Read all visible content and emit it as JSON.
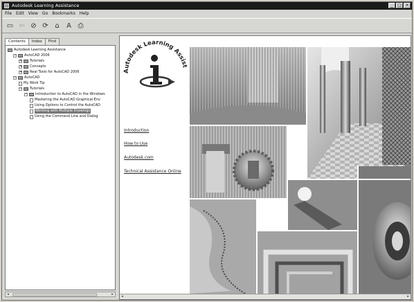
{
  "window": {
    "title": "Autodesk Learning Assistance",
    "controls": [
      "_",
      "□",
      "×"
    ]
  },
  "menu": [
    "File",
    "Edit",
    "View",
    "Go",
    "Bookmarks",
    "Help"
  ],
  "toolbar": {
    "buttons": [
      {
        "name": "hide-button",
        "icon": "hide-icon",
        "glyph": "▭"
      },
      {
        "name": "back-button",
        "icon": "back-arrow-icon",
        "glyph": "⇦"
      },
      {
        "name": "stop-button",
        "icon": "stop-icon",
        "glyph": "⊘"
      },
      {
        "name": "refresh-button",
        "icon": "refresh-icon",
        "glyph": "⟳"
      },
      {
        "name": "home-button",
        "icon": "home-icon",
        "glyph": "⌂"
      },
      {
        "name": "font-button",
        "icon": "font-icon",
        "glyph": "A"
      },
      {
        "name": "print-button",
        "icon": "print-icon",
        "glyph": "⎙"
      }
    ]
  },
  "nav": {
    "tabs": [
      "Contents",
      "Index",
      "Find"
    ],
    "active_tab": 0,
    "tree": [
      {
        "label": "Autodesk Learning Assistance",
        "level": 0,
        "expander": "",
        "icon": "book",
        "selected": false
      },
      {
        "label": "AutoCAD 2006",
        "level": 1,
        "expander": "−",
        "icon": "book",
        "selected": false
      },
      {
        "label": "Tutorials",
        "level": 2,
        "expander": "+",
        "icon": "book",
        "selected": false
      },
      {
        "label": "Concepts",
        "level": 2,
        "expander": "+",
        "icon": "book",
        "selected": false
      },
      {
        "label": "Real Tools for AutoCAD 2006",
        "level": 2,
        "expander": "+",
        "icon": "book",
        "selected": false
      },
      {
        "label": "AutoCAD",
        "level": 1,
        "expander": "−",
        "icon": "book",
        "selected": false
      },
      {
        "label": "My Work Tip",
        "level": 2,
        "expander": "",
        "icon": "page",
        "selected": false
      },
      {
        "label": "Tutorials",
        "level": 2,
        "expander": "−",
        "icon": "book",
        "selected": false
      },
      {
        "label": "Introduction to AutoCAD in the Windows",
        "level": 3,
        "expander": "−",
        "icon": "book",
        "selected": false
      },
      {
        "label": "Mastering the AutoCAD Graphical Env",
        "level": 4,
        "expander": "",
        "icon": "page",
        "selected": false
      },
      {
        "label": "Using Options to Control the AutoCAD",
        "level": 4,
        "expander": "",
        "icon": "page",
        "selected": false
      },
      {
        "label": "Working with Multiple Drawings",
        "level": 4,
        "expander": "",
        "icon": "page",
        "selected": true
      },
      {
        "label": "Using the Command Line and Dialog",
        "level": 4,
        "expander": "",
        "icon": "page",
        "selected": false
      }
    ]
  },
  "content": {
    "logo_text": "Autodesk Learning Assistance",
    "links": [
      "Introduction",
      "How to Use",
      "Autodesk.com",
      "Technical Assistance Online"
    ],
    "accent": "#2a2a2a"
  }
}
